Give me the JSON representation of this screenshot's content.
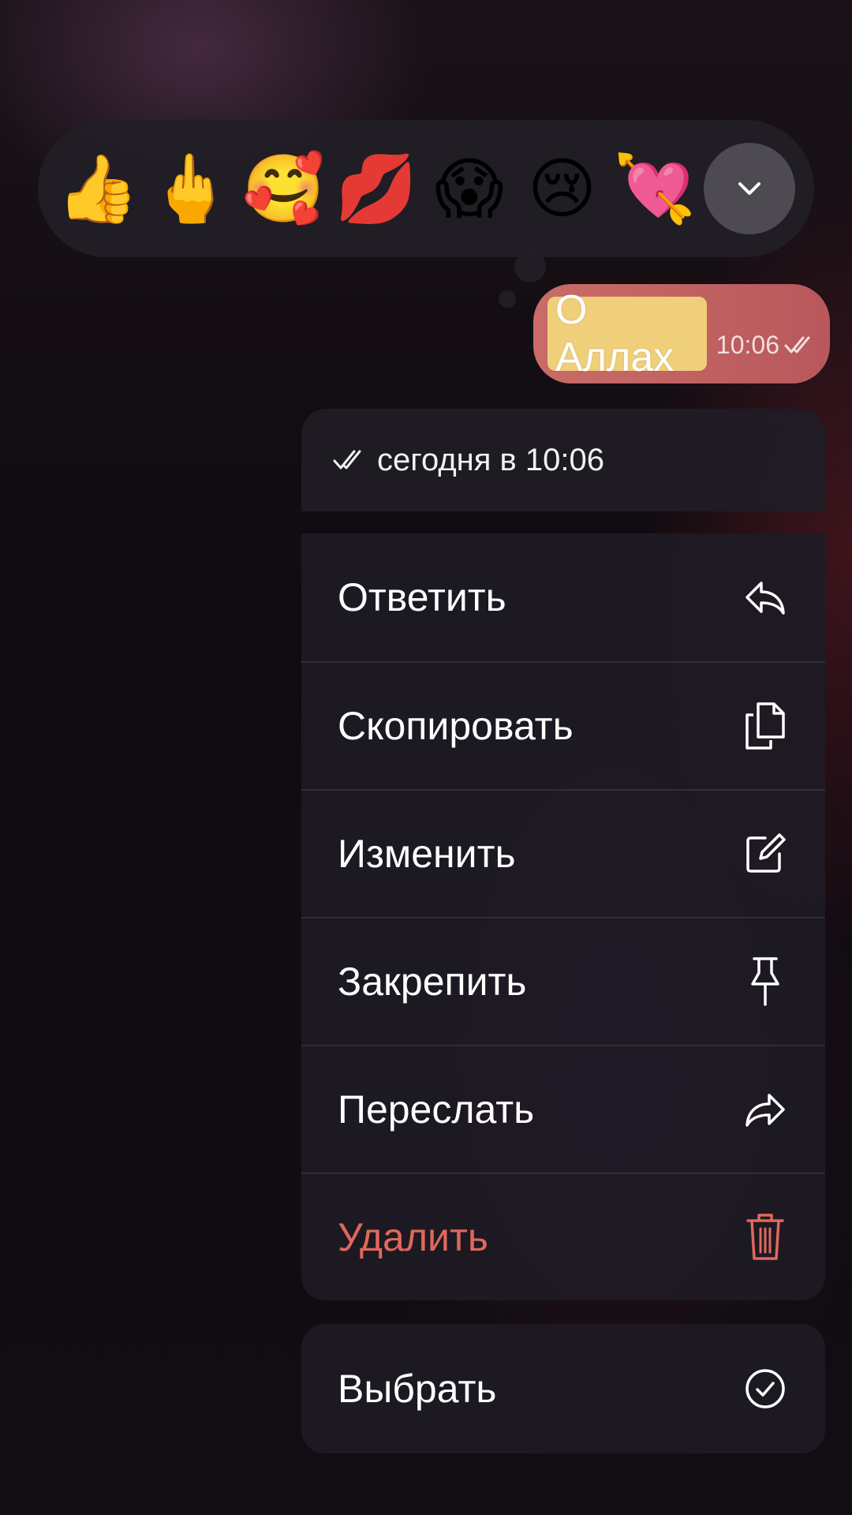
{
  "reactions": [
    {
      "name": "thumbs-up",
      "glyph": "👍"
    },
    {
      "name": "middle-finger",
      "glyph": "🖕"
    },
    {
      "name": "smiling-face-with-hearts",
      "glyph": "🥰"
    },
    {
      "name": "kiss-mark",
      "glyph": "💋"
    },
    {
      "name": "screaming-face",
      "glyph": "😱"
    },
    {
      "name": "crying-face",
      "glyph": "😢"
    },
    {
      "name": "heart-with-arrow",
      "glyph": "💘"
    }
  ],
  "message": {
    "text": "О Аллах",
    "time": "10:06"
  },
  "menu": {
    "header": "сегодня в 10:06",
    "items": [
      {
        "label": "Ответить",
        "icon": "reply-icon"
      },
      {
        "label": "Скопировать",
        "icon": "copy-icon"
      },
      {
        "label": "Изменить",
        "icon": "edit-icon"
      },
      {
        "label": "Закрепить",
        "icon": "pin-icon"
      },
      {
        "label": "Переслать",
        "icon": "forward-icon"
      },
      {
        "label": "Удалить",
        "icon": "trash-icon"
      }
    ],
    "select": {
      "label": "Выбрать",
      "icon": "checkmark-circle-icon"
    }
  },
  "colors": {
    "bubble": "#c0625f",
    "highlight": "#f0cf7a",
    "danger": "#e0685a",
    "menu_bg": "#1e1a24"
  }
}
